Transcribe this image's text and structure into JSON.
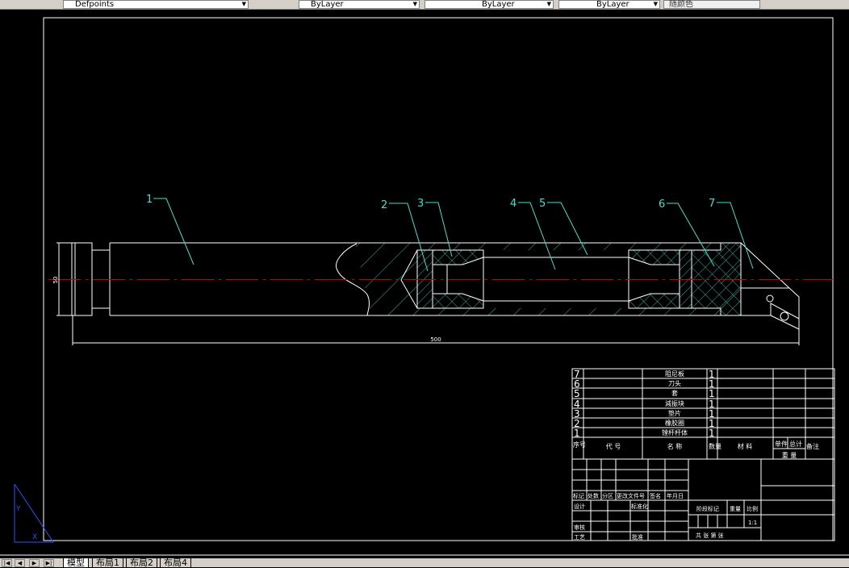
{
  "toolbar": {
    "plot_style": "Defpoints",
    "color": "ByLayer",
    "linetype": "ByLayer",
    "lineweight": "ByLayer",
    "plotstyle_box": "随颜色"
  },
  "drawing": {
    "dimension_length": "500",
    "dimension_diameter": "50",
    "balloons": [
      "1",
      "2",
      "3",
      "4",
      "5",
      "6",
      "7"
    ],
    "colors": {
      "geometry": "#ffffff",
      "hatch": "#40e0d0",
      "centerline": "#cc0000",
      "leader": "#40e0d0"
    }
  },
  "bom": {
    "rows": [
      {
        "no": "7",
        "code": "",
        "name": "阻尼板",
        "qty": "1"
      },
      {
        "no": "6",
        "code": "",
        "name": "刀头",
        "qty": "1"
      },
      {
        "no": "5",
        "code": "",
        "name": "套",
        "qty": "1"
      },
      {
        "no": "4",
        "code": "",
        "name": "減振块",
        "qty": "1"
      },
      {
        "no": "3",
        "code": "",
        "name": "垫片",
        "qty": "1"
      },
      {
        "no": "2",
        "code": "",
        "name": "橡胶圈",
        "qty": "1"
      },
      {
        "no": "1",
        "code": "",
        "name": "镗杆杆体",
        "qty": "1"
      }
    ],
    "header": {
      "no": "序号",
      "code": "代 号",
      "name": "名 称",
      "qty": "数量",
      "material": "材 料",
      "single": "单件",
      "total": "总计",
      "weight": "重 量",
      "remark": "备注"
    }
  },
  "title_block": {
    "mark": "标记",
    "count": "处数",
    "zone": "分区",
    "change_doc": "更改文件号",
    "sign": "签名",
    "date": "年月日",
    "design": "设计",
    "standard": "标准化",
    "review": "审核",
    "process": "工艺",
    "approve": "批准",
    "stage": "阶段标记",
    "weight": "重量",
    "scale": "比例",
    "scale_value": "1:1",
    "sheets": "共  张 第  张"
  },
  "layout_tabs": [
    {
      "label": "模型",
      "active": true
    },
    {
      "label": "布局1",
      "active": false
    },
    {
      "label": "布局2",
      "active": false
    },
    {
      "label": "布局4",
      "active": false
    }
  ]
}
